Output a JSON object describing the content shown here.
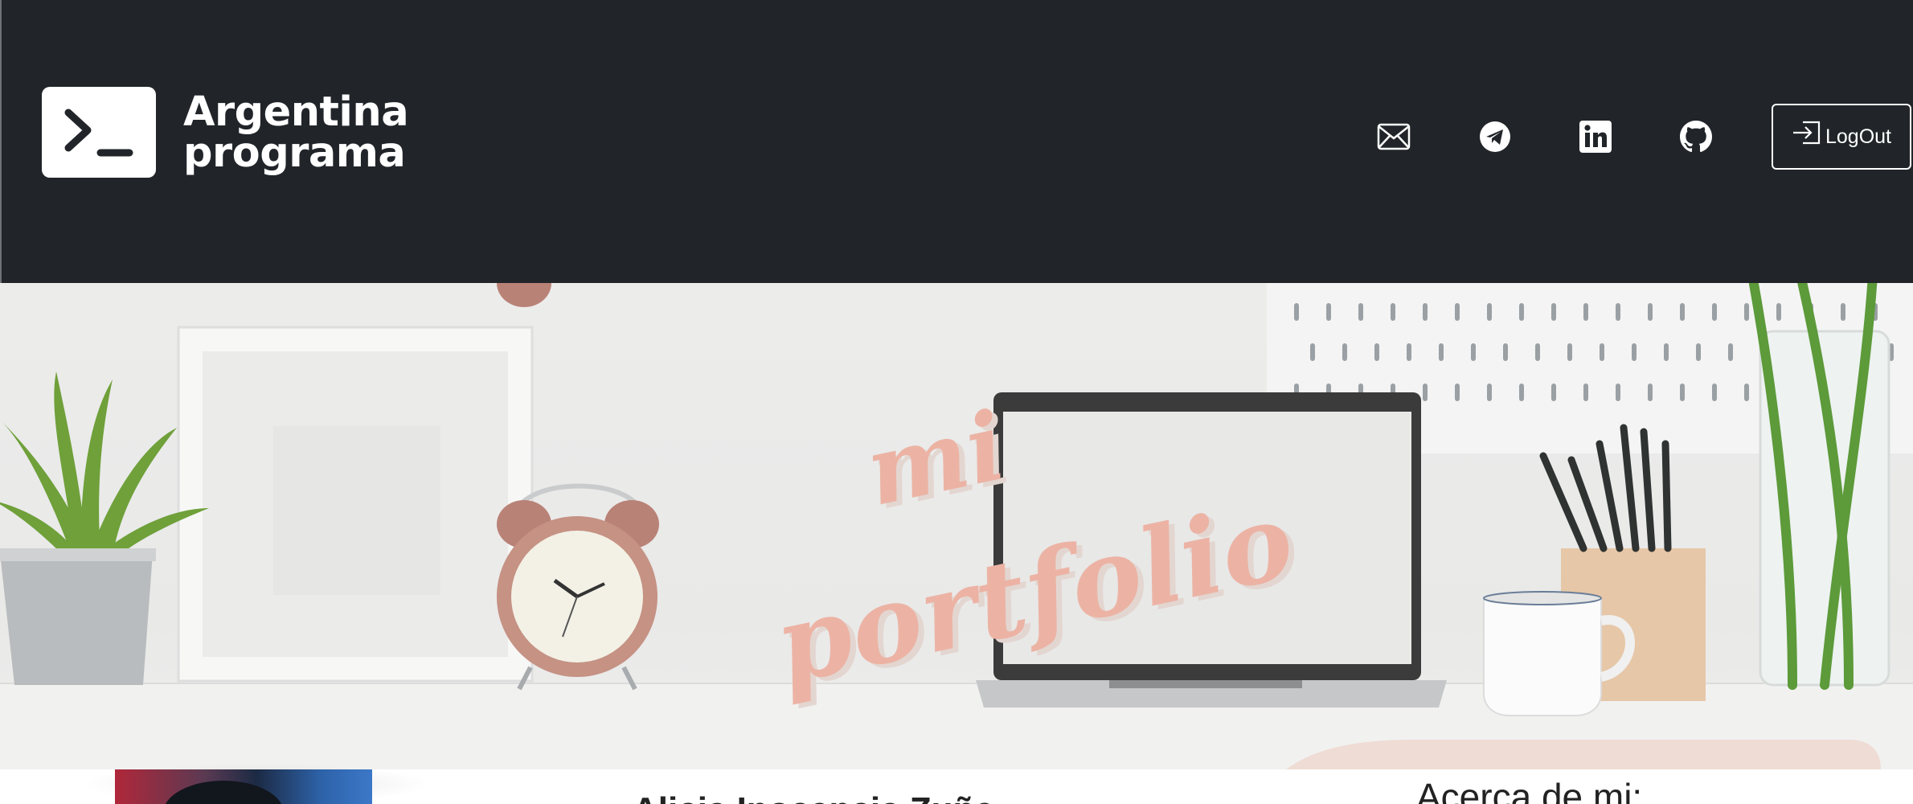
{
  "header": {
    "brand_line1": "Argentina",
    "brand_line2": "programa",
    "logout_label": "LogOut",
    "social_icons": [
      "email-icon",
      "telegram-icon",
      "linkedin-icon",
      "github-icon"
    ],
    "background_color": "#212529"
  },
  "hero": {
    "title_line1": "mi",
    "title_line2": "portfolio",
    "title_color": "#ecb3a4"
  },
  "profile": {
    "name": "Alicia Inocencia Zuñe",
    "about_title": "Acerca de mi:"
  }
}
